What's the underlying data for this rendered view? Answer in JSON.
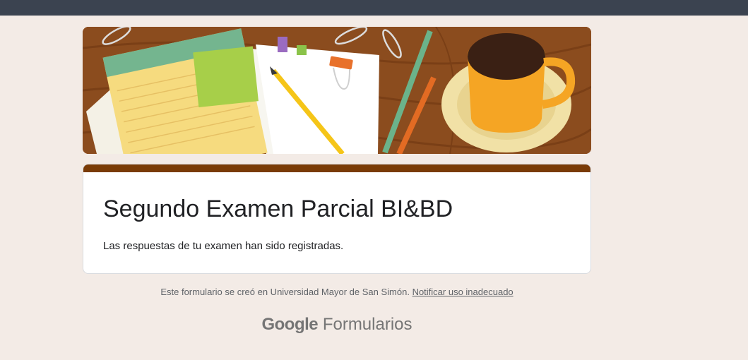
{
  "form": {
    "title": "Segundo Examen Parcial BI&BD",
    "confirmation_message": "Las respuestas de tu examen han sido registradas."
  },
  "footer": {
    "note_prefix": "Este formulario se creó en Universidad Mayor de San Simón.",
    "report_link": "Notificar uso inadecuado"
  },
  "brand": {
    "google": "Google",
    "product": "Formularios"
  },
  "colors": {
    "accent": "#7a3b06",
    "background": "#f3ebe6",
    "topbar": "#3b4350"
  },
  "icons": {
    "banner": "desk-with-notepad-pencil-coffee-illustration"
  }
}
